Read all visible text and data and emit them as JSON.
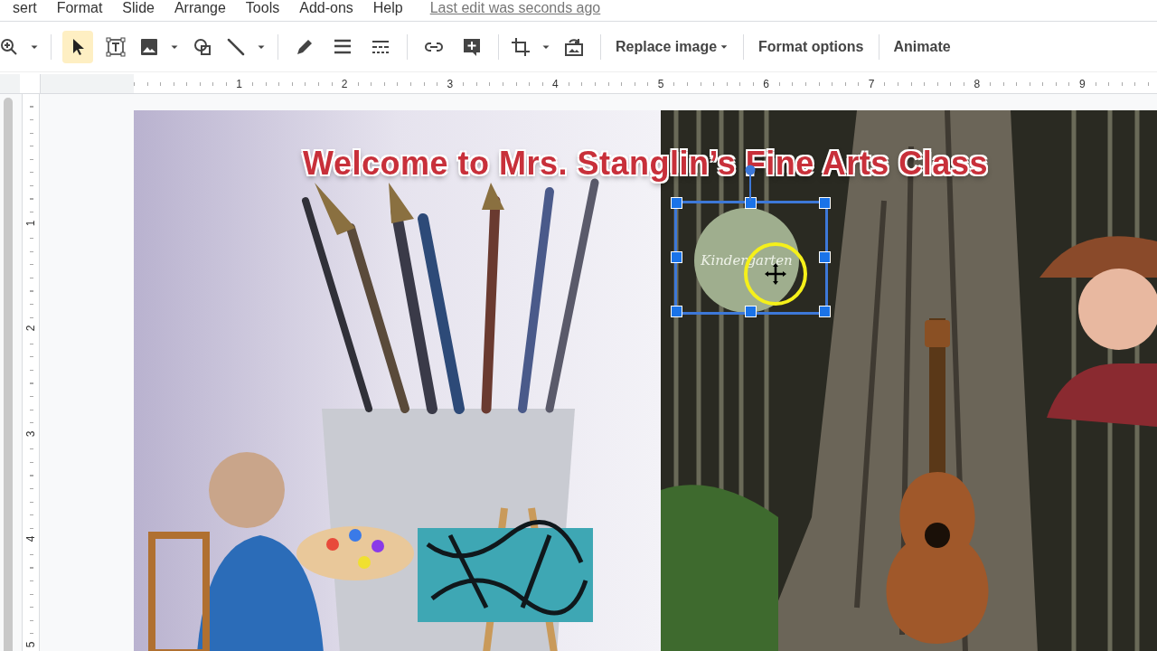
{
  "menu": {
    "items": [
      "sert",
      "Format",
      "Slide",
      "Arrange",
      "Tools",
      "Add-ons",
      "Help"
    ],
    "last_edit": "Last edit was seconds ago"
  },
  "toolbar": {
    "groups": [
      [
        {
          "kind": "zoom",
          "selected": false,
          "dropdown": true
        }
      ],
      [
        {
          "kind": "select",
          "selected": true,
          "dropdown": false
        },
        {
          "kind": "textbox",
          "selected": false,
          "dropdown": false
        },
        {
          "kind": "image",
          "selected": false,
          "dropdown": true
        },
        {
          "kind": "shape",
          "selected": false,
          "dropdown": false
        },
        {
          "kind": "line",
          "selected": false,
          "dropdown": true
        }
      ],
      [
        {
          "kind": "pen",
          "selected": false,
          "dropdown": false
        },
        {
          "kind": "weight",
          "selected": false,
          "dropdown": false
        },
        {
          "kind": "dash",
          "selected": false,
          "dropdown": false
        }
      ],
      [
        {
          "kind": "link",
          "selected": false,
          "dropdown": false
        },
        {
          "kind": "comment",
          "selected": false,
          "dropdown": false
        }
      ],
      [
        {
          "kind": "crop",
          "selected": false,
          "dropdown": true
        },
        {
          "kind": "reset",
          "selected": false,
          "dropdown": false
        }
      ]
    ],
    "buttons": [
      {
        "label": "Replace image",
        "dropdown": true
      },
      {
        "label": "Format options",
        "dropdown": false
      },
      {
        "label": "Animate",
        "dropdown": false
      }
    ]
  },
  "ruler": {
    "horizontal": [
      "1",
      "2",
      "3",
      "4",
      "5",
      "6",
      "7",
      "8",
      "9"
    ],
    "vertical": [
      "1",
      "2",
      "3",
      "4",
      "5"
    ]
  },
  "slide": {
    "title": "Welcome to Mrs. Stanglin’s Fine Arts Class",
    "logo": {
      "text": "Kindergarten",
      "selected": true
    }
  }
}
